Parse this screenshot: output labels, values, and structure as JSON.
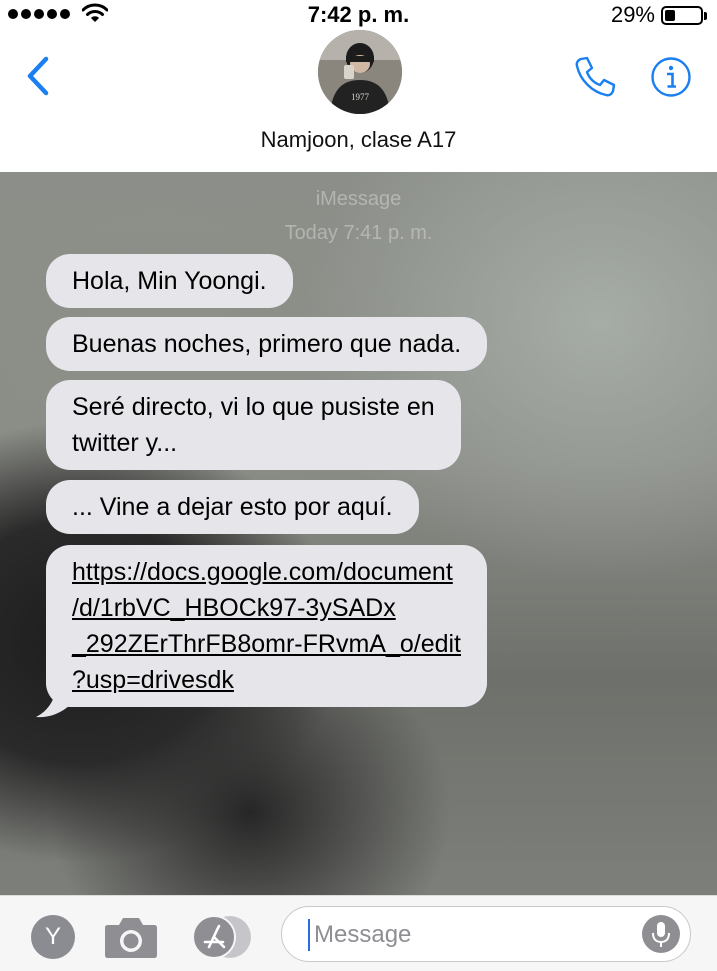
{
  "status_bar": {
    "time": "7:42 p. m.",
    "battery_percent": "29%",
    "battery_level": 0.29,
    "signal_bars": 5
  },
  "header": {
    "contact_name": "Namjoon, clase A17",
    "avatar_shirt_text": "1977",
    "accent_color": "#1a7ff0"
  },
  "conversation": {
    "service_label": "iMessage",
    "timestamp": "Today 7:41 p. m.",
    "messages": [
      {
        "text": "Hola, Min Yoongi."
      },
      {
        "text": "Buenas noches, primero que nada."
      },
      {
        "line1": "Seré directo, vi lo que pusiste en",
        "line2": "twitter y..."
      },
      {
        "text": "... Vine a dejar esto por aquí."
      },
      {
        "line1": "https://docs.google.com/document",
        "line2": "/d/1rbVC_HBOCk97-3ySADx",
        "line3": "_292ZErThrFB8omr-FRvmA_o/edit",
        "line4": "?usp=drivesdk"
      }
    ],
    "bubble_color": "#e5e5ea"
  },
  "input_bar": {
    "apps_button_label": "Y",
    "placeholder": "Message",
    "icons": [
      "camera-icon",
      "app-store-icon",
      "microphone-icon"
    ]
  }
}
